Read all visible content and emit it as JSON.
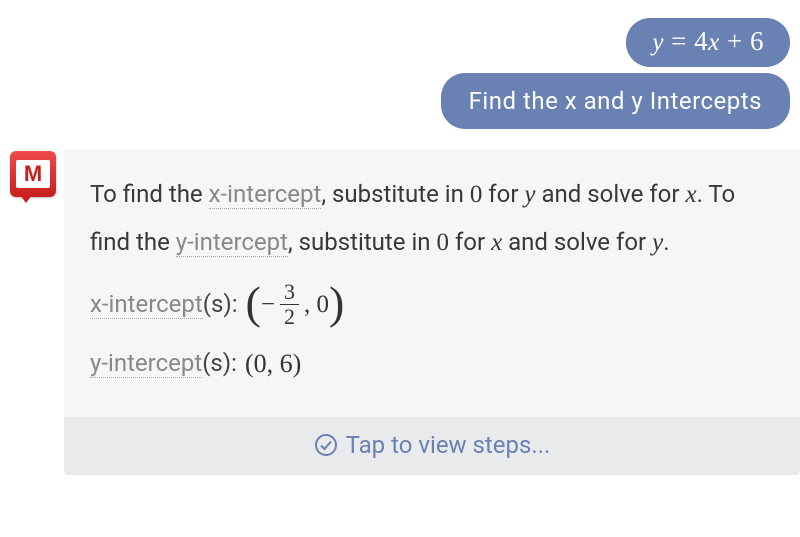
{
  "user": {
    "equation": "y = 4x + 6",
    "equation_parts": {
      "y": "y",
      "eq": " = ",
      "coef": "4",
      "x": "x",
      "plus": " + ",
      "const": "6"
    },
    "question": "Find the x and y Intercepts"
  },
  "answer": {
    "explanation": {
      "p1a": "To find the ",
      "xint": "x-intercept",
      "p1b": ", substitute in ",
      "zero1": "0",
      "p1c": " for ",
      "y1": "y",
      "p1d": " and solve for ",
      "x1": "x",
      "p1e": ". To find the ",
      "yint": "y-intercept",
      "p1f": ", substitute in ",
      "zero2": "0",
      "p1g": " for ",
      "x2": "x",
      "p1h": " and solve for ",
      "y2": "y",
      "p1i": "."
    },
    "results": {
      "xlabel_link": "x-intercept",
      "xlabel_suffix": "(s): ",
      "x_neg": "−",
      "x_frac_num": "3",
      "x_frac_den": "2",
      "x_rest": ", 0",
      "ylabel_link": "y-intercept",
      "ylabel_suffix": "(s): ",
      "y_value": "(0, 6)"
    }
  },
  "steps_button": "Tap to view steps...",
  "icons": {
    "app_letter": "M"
  }
}
